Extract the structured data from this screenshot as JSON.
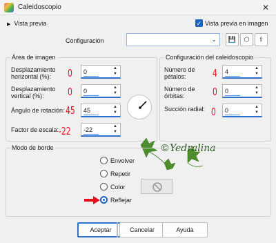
{
  "window": {
    "title": "Caleidoscopio",
    "close_glyph": "✕",
    "icon": "kaleidoscope-app-icon"
  },
  "preview": {
    "toggle_label": "Vista previa",
    "image_preview_label": "Vista previa en imagen",
    "image_preview_checked": true
  },
  "configuration": {
    "label": "Configuración",
    "value": "",
    "buttons": [
      "save-icon",
      "cube-icon",
      "export-icon"
    ]
  },
  "image_area": {
    "title": "Área de imagen",
    "fields": [
      {
        "label": "Desplazamiento horizontal (%):",
        "value": "0",
        "annotation": "0"
      },
      {
        "label": "Desplazamiento vertical (%):",
        "value": "0",
        "annotation": "0"
      },
      {
        "label": "Ángulo de rotación:",
        "value": "45",
        "annotation": "45"
      },
      {
        "label": "Factor de escala:",
        "value": "-22",
        "annotation": "-22"
      }
    ]
  },
  "kaleidoscope": {
    "title": "Configuración del caleidoscopio",
    "fields": [
      {
        "label": "Número de pétalos:",
        "value": "4",
        "annotation": "4"
      },
      {
        "label": "Número de órbitas:",
        "value": "0",
        "annotation": "0"
      },
      {
        "label": "Succión radial:",
        "value": "0",
        "annotation": "0"
      }
    ]
  },
  "border_mode": {
    "title": "Modo de borde",
    "options": [
      {
        "label": "Envolver",
        "selected": false
      },
      {
        "label": "Repetir",
        "selected": false
      },
      {
        "label": "Color",
        "selected": false
      },
      {
        "label": "Reflejar",
        "selected": true
      }
    ]
  },
  "watermark": {
    "text": "©Yedralina"
  },
  "footer": {
    "ok": "Aceptar",
    "cancel": "Cancelar",
    "help": "Ayuda"
  },
  "colors": {
    "accent": "#2c6fd1",
    "annotation_red": "#e8111b",
    "watermark_green": "#1e4e12"
  }
}
